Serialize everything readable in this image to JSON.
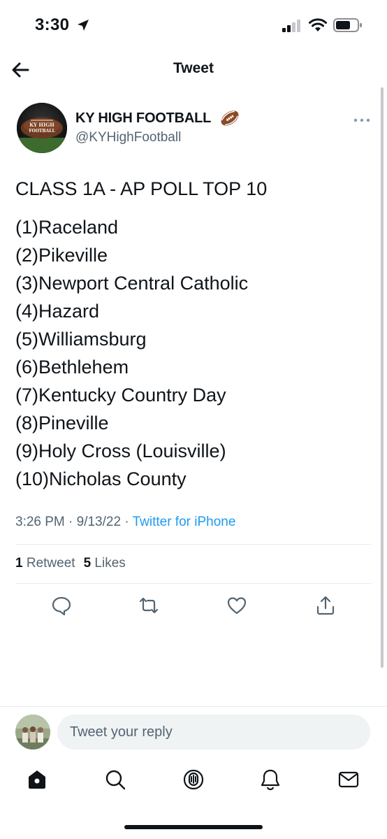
{
  "status_bar": {
    "time": "3:30"
  },
  "header": {
    "title": "Tweet"
  },
  "tweet": {
    "author_name": "KY HIGH FOOTBALL",
    "author_handle": "@KYHighFootball",
    "avatar_text": [
      "KY HIGH",
      "FOOTBALL"
    ],
    "headline": "CLASS 1A - AP POLL TOP 10",
    "poll_items": [
      "(1)Raceland",
      "(2)Pikeville",
      "(3)Newport Central Catholic",
      "(4)Hazard",
      "(5)Williamsburg",
      "(6)Bethlehem",
      "(7)Kentucky Country Day",
      "(8)Pineville",
      "(9)Holy Cross (Louisville)",
      "(10)Nicholas County"
    ],
    "timestamp": "3:26 PM · 9/13/22 · ",
    "source": "Twitter for iPhone",
    "retweet_count": "1",
    "retweet_label": "Retweet",
    "like_count": "5",
    "like_label": "Likes"
  },
  "reply": {
    "placeholder": "Tweet your reply"
  },
  "icons": {
    "back": "arrow-left-icon",
    "more": "more-dots-icon",
    "actions": [
      "reply-icon",
      "retweet-icon",
      "like-icon",
      "share-icon"
    ],
    "nav": [
      "home-icon",
      "search-icon",
      "spaces-icon",
      "notifications-icon",
      "messages-icon"
    ]
  },
  "colors": {
    "link": "#1d9bf0",
    "secondary_text": "#536471",
    "primary_text": "#0f1419",
    "reply_bg": "#eff3f4"
  }
}
